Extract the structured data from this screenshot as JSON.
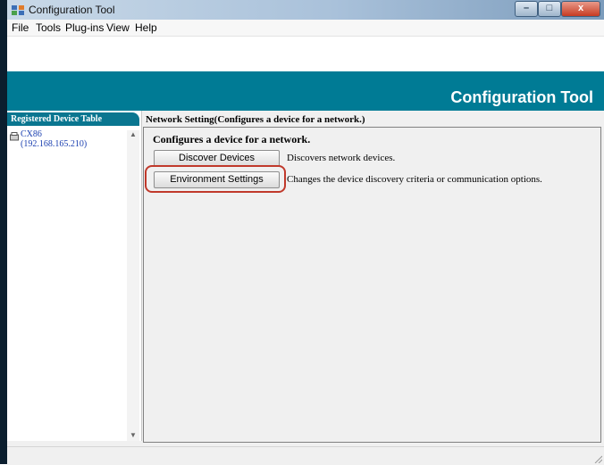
{
  "window": {
    "title": "Configuration Tool",
    "controls": {
      "minimize": "–",
      "maximize": "□",
      "close": "x"
    }
  },
  "menubar": {
    "items": [
      "File",
      "Tools",
      "Plug-ins",
      "View",
      "Help"
    ]
  },
  "banner": {
    "title": "Configuration Tool"
  },
  "sidebar": {
    "tab_label": "Registered Device Table",
    "devices": [
      {
        "name": "CX86",
        "ip": "(192.168.165.210)"
      }
    ]
  },
  "main": {
    "header": "Network Setting(Configures a device for a network.)",
    "heading": "Configures a device for a network.",
    "actions": [
      {
        "button": "Discover Devices",
        "description": "Discovers network devices."
      },
      {
        "button": "Environment Settings",
        "description": "Changes the device discovery criteria or communication options."
      }
    ]
  },
  "colors": {
    "banner": "#007b95",
    "highlight": "#c0392b",
    "link": "#1a3fb0"
  }
}
